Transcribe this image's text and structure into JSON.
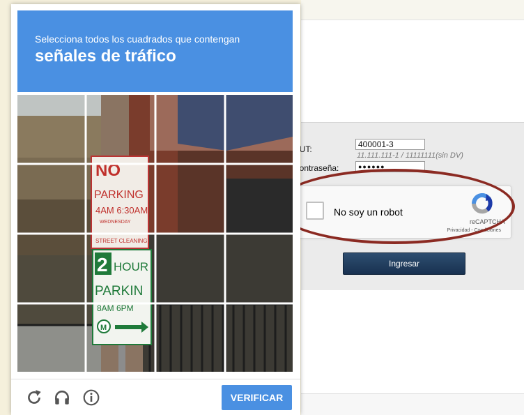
{
  "login": {
    "rut_label": "RUT:",
    "rut_value": "400001-3",
    "rut_hint": "11.111.111-1 / 11111111(sin DV)",
    "password_label": "Contraseña:",
    "password_value": "●●●●●●",
    "submit_label": "Ingresar"
  },
  "recaptcha": {
    "checkbox_label": "No soy un robot",
    "brand": "reCAPTCHA",
    "terms": "Privacidad - Condiciones"
  },
  "challenge": {
    "instruction": "Selecciona todos los cuadrados que contengan",
    "target": "señales de tráfico",
    "verify_label": "VERIFICAR",
    "footer_icons": [
      "reload-icon",
      "audio-headphones-icon",
      "info-icon"
    ],
    "grid_rows": 4,
    "grid_cols": 4,
    "sign_text": {
      "no": "NO",
      "parking": "PARKING",
      "hours": "4AM 6:30AM",
      "day": "WEDNESDAY",
      "street_cleaning": "STREET CLEANING",
      "two": "2",
      "hour": "HOUR",
      "parkin": "PARKIN",
      "time": "8AM 6PM",
      "m": "M"
    }
  },
  "colors": {
    "accent_blue": "#4a90e2",
    "button_navy": "#1f3a5a",
    "oval_red": "#8b2a22",
    "page_gray": "#ebebeb"
  }
}
